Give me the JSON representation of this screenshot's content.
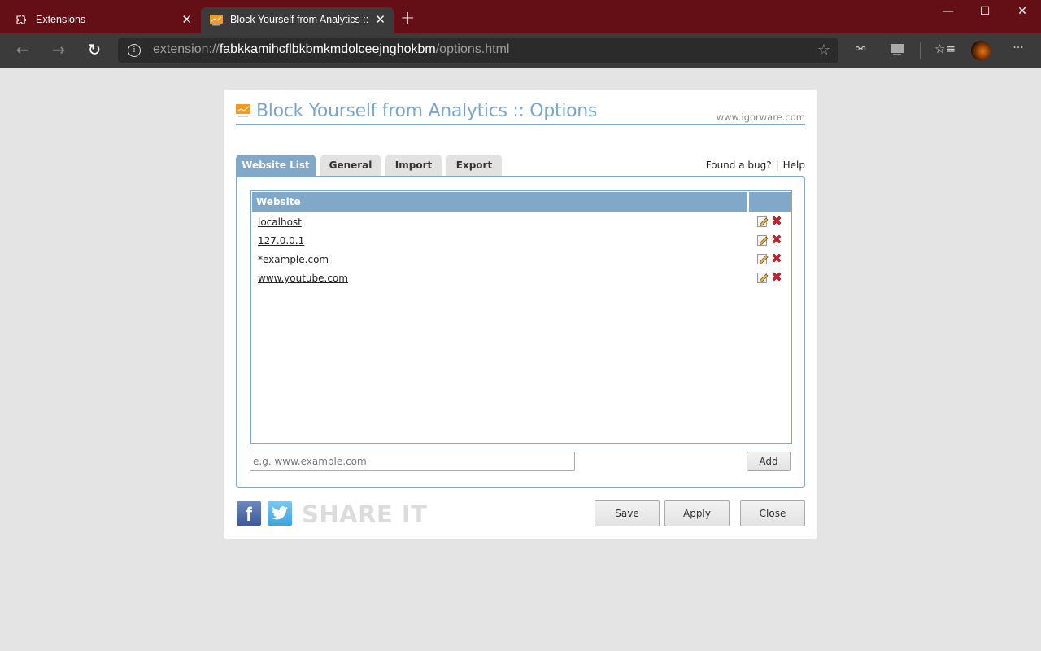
{
  "browser": {
    "tabs": [
      {
        "label": "Extensions",
        "icon": "puzzle-icon",
        "active": false
      },
      {
        "label": "Block Yourself from Analytics :: Options",
        "icon": "analytics-logo-icon",
        "active": true
      }
    ],
    "new_tab": "+",
    "window_controls": {
      "minimize": "—",
      "maximize": "☐",
      "close": "✕"
    },
    "address": {
      "scheme": "extension://",
      "host": "fabkkamihcflbkbmkmdolceejnghokbm",
      "path": "/options.html"
    },
    "icons": {
      "back": "←",
      "forward": "→",
      "reload": "↻",
      "info": "i",
      "favorite": "☆",
      "extension1": "⚯",
      "extension2": "▬",
      "favorites_list": "☆≡",
      "more": "···"
    }
  },
  "page": {
    "title": "Block Yourself from Analytics :: Options",
    "site_link": "www.igorware.com",
    "tabs": [
      "Website List",
      "General",
      "Import",
      "Export"
    ],
    "active_tab": "Website List",
    "links": {
      "bug": "Found a bug?",
      "separator": "|",
      "help": "Help"
    },
    "table": {
      "header": "Website",
      "rows": [
        {
          "site": "localhost",
          "link": true
        },
        {
          "site": "127.0.0.1",
          "link": true
        },
        {
          "site": "*example.com",
          "link": false
        },
        {
          "site": "www.youtube.com",
          "link": true
        }
      ]
    },
    "input_placeholder": "e.g. www.example.com",
    "input_value": "",
    "add_label": "Add",
    "share": {
      "facebook": "f",
      "twitter": "🐦",
      "text": "SHARE IT"
    },
    "buttons": {
      "save": "Save",
      "apply": "Apply",
      "close": "Close"
    },
    "colors": {
      "accent": "#81a8c9",
      "titlebar": "#640f16",
      "title_text": "#7aa6cc",
      "delete": "#d0202a"
    }
  }
}
